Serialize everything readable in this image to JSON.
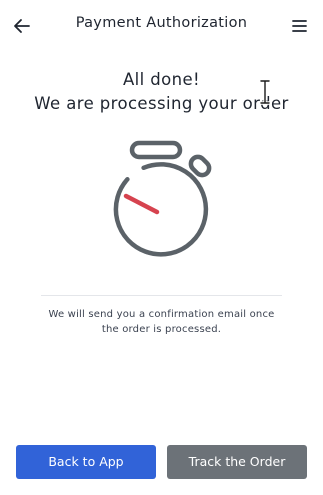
{
  "header": {
    "title": "Payment Authorization",
    "back_icon": "arrow-left-icon",
    "menu_icon": "hamburger-menu-icon"
  },
  "main": {
    "headline_line1": "All done!",
    "headline_line2": "We are processing your order",
    "illustration_icon": "stopwatch-icon",
    "message": "We will send you a confirmation email once the order is processed."
  },
  "actions": {
    "back_label": "Back to App",
    "track_label": "Track the Order"
  },
  "colors": {
    "primary": "#3163d8",
    "secondary": "#6c7278",
    "illustration": "#5b6268",
    "stopwatch_hand": "#d6434f"
  }
}
